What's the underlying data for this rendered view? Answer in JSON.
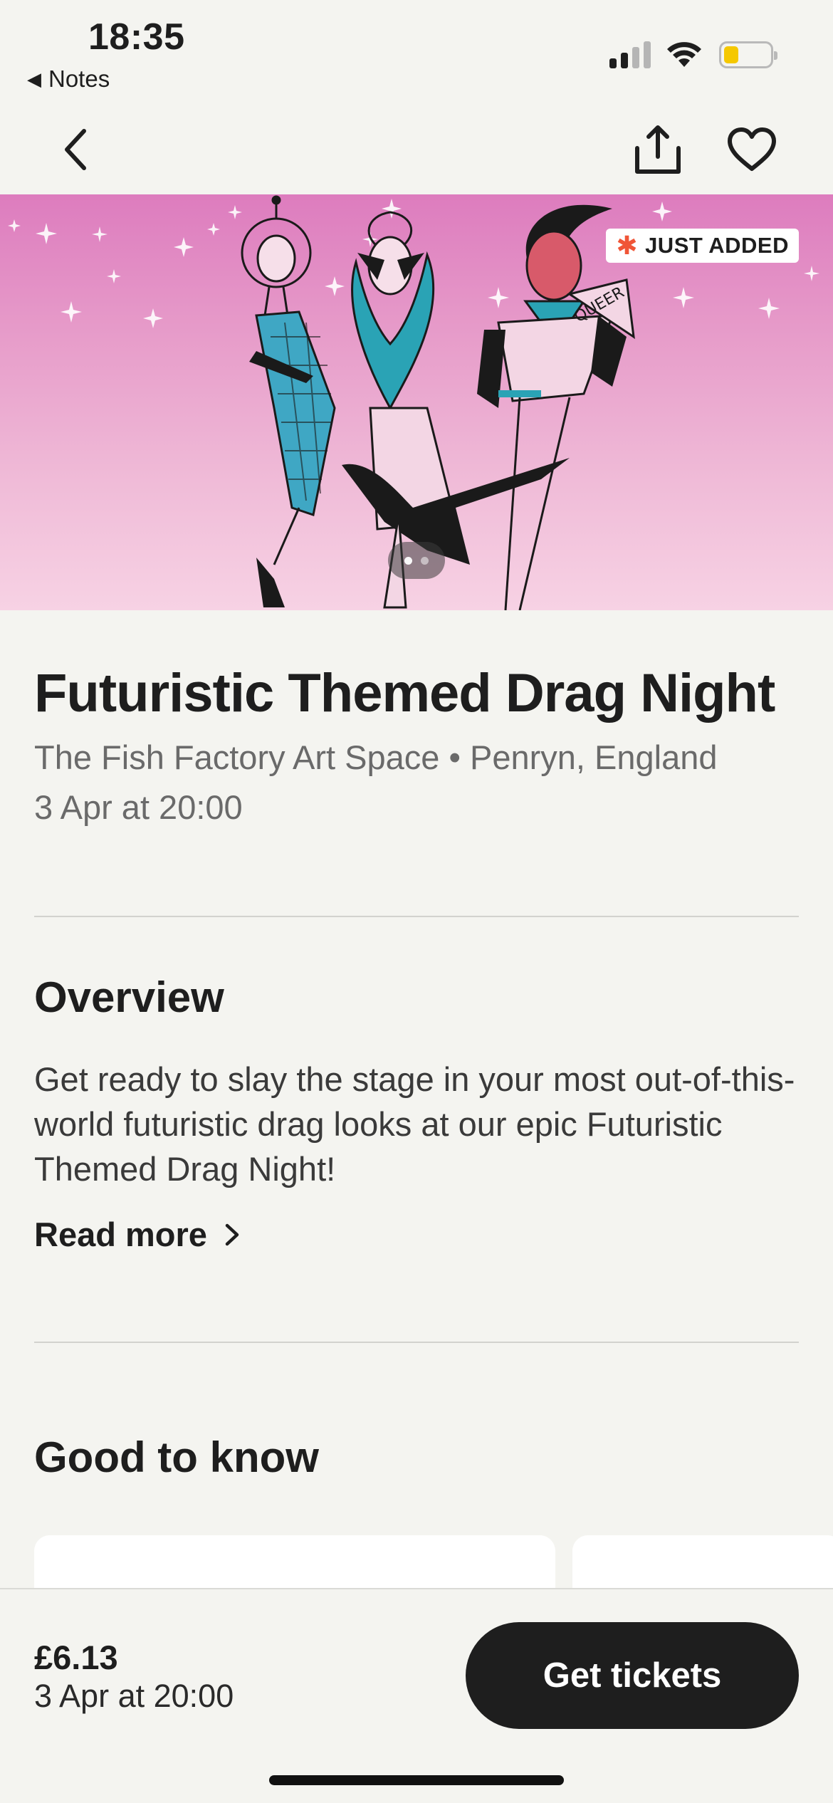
{
  "status_bar": {
    "time": "18:35",
    "back_app_label": "Notes"
  },
  "nav": {
    "back_icon": "chevron-left-icon",
    "share_icon": "share-icon",
    "like_icon": "heart-icon"
  },
  "hero": {
    "badge_label": "JUST ADDED",
    "badge_star": "✱",
    "badge_accent": "#f05537",
    "pager_current": 1,
    "pager_total": 2,
    "fan_text": "QUEER"
  },
  "event": {
    "title": "Futuristic Themed Drag Night",
    "venue_line": "The Fish Factory Art Space • Penryn, England",
    "date_line": "3 Apr at 20:00"
  },
  "overview": {
    "heading": "Overview",
    "text": "Get ready to slay the stage in your most out-of-this-world futuristic drag looks at our epic Futuristic Themed Drag Night!",
    "read_more_label": "Read more"
  },
  "good_to_know": {
    "heading": "Good to know"
  },
  "bottom_bar": {
    "price": "£6.13",
    "date": "3 Apr at 20:00",
    "cta_label": "Get tickets"
  },
  "colors": {
    "background": "#f4f4f0",
    "text": "#1e1e1e",
    "muted": "#6a6a6a",
    "cta_bg": "#1e1e1e",
    "hero_pink": "#e79dca",
    "teal": "#2aa3b5"
  }
}
